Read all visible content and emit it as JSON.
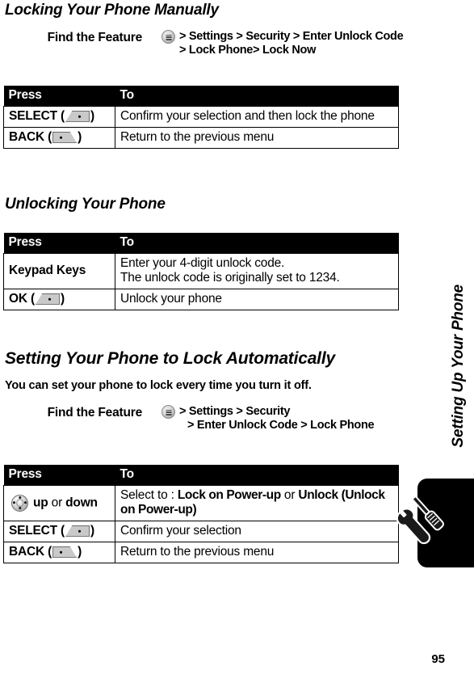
{
  "document": {
    "page_number": "95",
    "chapter_tab_label": "Setting Up Your Phone",
    "chapter_tab_icon": "wrench-screwdriver-icon"
  },
  "sections": [
    {
      "heading": "Locking Your Phone Manually",
      "find_the_feature": {
        "label": "Find the Feature",
        "menu_icon": "menu-circle-icon",
        "lines": [
          "> Settings > Security > Enter Unlock Code",
          "> Lock Phone> Lock Now"
        ]
      },
      "table": {
        "headers": [
          "Press",
          "To"
        ],
        "rows": [
          {
            "press": "SELECT",
            "key_icon": "softkey-left-icon",
            "to": "Confirm your selection and then lock the phone"
          },
          {
            "press": "BACK",
            "key_icon": "softkey-right-icon",
            "to": "Return to the previous menu"
          }
        ]
      }
    },
    {
      "heading": "Unlocking Your Phone",
      "table": {
        "headers": [
          "Press",
          "To"
        ],
        "rows": [
          {
            "press": "Keypad Keys",
            "key_icon": "",
            "to_line1": "Enter your 4-digit unlock code.",
            "to_line2": "The unlock code is originally set to 1234."
          },
          {
            "press": "OK",
            "key_icon": "softkey-left-icon",
            "to": "Unlock your phone"
          }
        ]
      }
    },
    {
      "heading": "Setting Your Phone to Lock Automatically",
      "intro": "You can set your phone to lock every time you turn it off.",
      "find_the_feature": {
        "label": "Find the Feature",
        "menu_icon": "menu-circle-icon",
        "lines": [
          "> Settings > Security",
          "> Enter Unlock Code > Lock Phone"
        ]
      },
      "table": {
        "headers": [
          "Press",
          "To"
        ],
        "rows": [
          {
            "press_icon": "nav-key-icon",
            "press_prefix": "up",
            "press_mid": " or ",
            "press_suffix": "down",
            "to_prefix": "Select to : ",
            "to_bold1": "Lock on Power-up",
            "to_mid": " or ",
            "to_bold2": "Unlock (Unlock on Power-up)"
          },
          {
            "press": "SELECT",
            "key_icon": "softkey-left-icon",
            "to": "Confirm your selection"
          },
          {
            "press": "BACK",
            "key_icon": "softkey-right-icon",
            "to": "Return to the previous menu"
          }
        ]
      }
    }
  ]
}
